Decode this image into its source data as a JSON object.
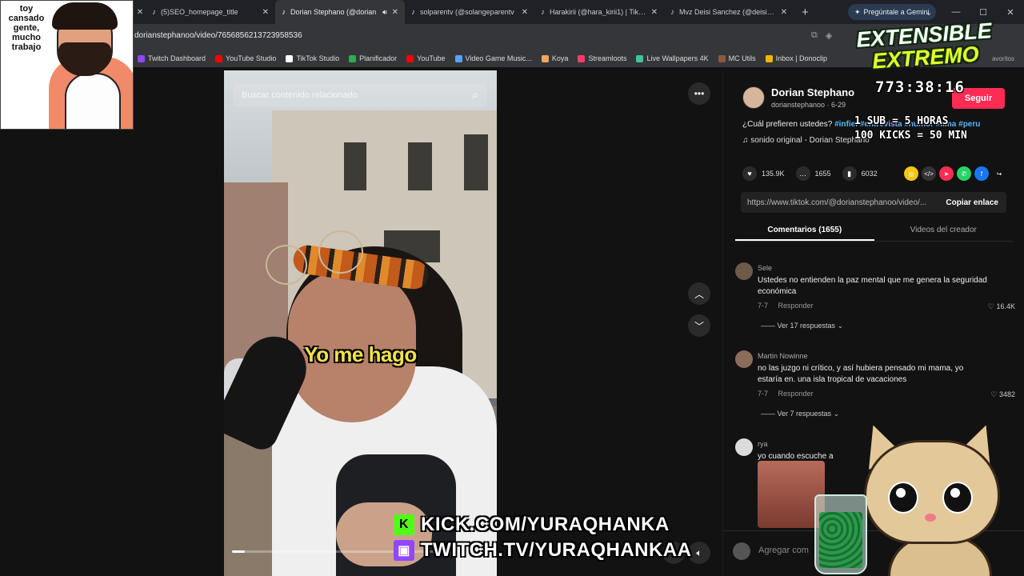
{
  "browser": {
    "tabs": [
      {
        "title": "(5)SEO_homepage_title"
      },
      {
        "title": "Dorian Stephano (@dorian"
      },
      {
        "title": "solparentv (@solangeparentv"
      },
      {
        "title": "Harakirii (@hara_kirii1) | TikTok"
      },
      {
        "title": "Mvz Deisi Sanchez (@deisialei"
      }
    ],
    "new_tab": "+",
    "gemini_label": "Pregúntale a Gemini",
    "url": "dorianstephanoo/video/7656856213723958536",
    "bookmarks": [
      {
        "label": "Twitch Dashboard",
        "color": "#9146ff"
      },
      {
        "label": "YouTube Studio",
        "color": "#ff0000"
      },
      {
        "label": "TikTok Studio",
        "color": "#ffffff"
      },
      {
        "label": "Planificador",
        "color": "#34a853"
      },
      {
        "label": "YouTube",
        "color": "#ff0000"
      },
      {
        "label": "Video Game Music...",
        "color": "#5aa0ff"
      },
      {
        "label": "Koya",
        "color": "#f2a65a"
      },
      {
        "label": "Streamloots",
        "color": "#ff3b6b"
      },
      {
        "label": "Live Wallpapers 4K",
        "color": "#3fc3a0"
      },
      {
        "label": "MC Utils",
        "color": "#8a5a3a"
      },
      {
        "label": "Inbox | Donoclip",
        "color": "#f5b400"
      }
    ],
    "bookmarks_overflow": "avoritos"
  },
  "video": {
    "search_placeholder": "Buscar contenido relacionado",
    "caption": "Yo me hago",
    "progress": 0.05
  },
  "panel": {
    "creator_name": "Dorian Stephano",
    "creator_handle": "dorianstephanoo · 6-29",
    "follow_label": "Seguir",
    "description": "¿Cuál prefieren ustedes?",
    "description_tags": "#infiel #entrevista #humor #lima #peru",
    "sound": "sonido original - Dorian Stephano",
    "likes": "135.9K",
    "comments": "1655",
    "saves": "6032",
    "link": "https://www.tiktok.com/@dorianstephanoo/video/...",
    "copy_link": "Copiar enlace",
    "tab_comments": "Comentarios (1655)",
    "tab_creator": "Videos del creador",
    "comments_list": [
      {
        "user": "Sele",
        "text": "Ustedes no entienden la paz mental que me genera la seguridad económica",
        "date": "7-7",
        "reply": "Responder",
        "likes": "16.4K",
        "more": "Ver 17 respuestas"
      },
      {
        "user": "Martin Nowinne",
        "text": "no las juzgo ni crítico, y así hubiera pensado mi mama, yo estaría en. una isla tropical de vacaciones",
        "date": "7-7",
        "reply": "Responder",
        "likes": "3482",
        "more": "Ver 7 respuestas"
      },
      {
        "user": "rya",
        "text": "yo cuando escuche a"
      }
    ],
    "add_comment_placeholder": "Agregar com"
  },
  "overlay": {
    "guy_note": "toy cansado gente, mucho trabajo",
    "title_line1": "EXTENSIBLE",
    "title_line2": "EXTREMO",
    "timer": "773:38:16",
    "rule1": "1 SUB = 5 HORAS",
    "rule2": "100 KICKS = 50 MIN",
    "kick_url": "KICK.COM/YURAQHANKA",
    "twitch_url": "TWITCH.TV/YURAQHANKAA"
  },
  "colors": {
    "accent_red": "#fe2c55",
    "kick_green": "#53fc18",
    "twitch_purple": "#9146ff"
  }
}
